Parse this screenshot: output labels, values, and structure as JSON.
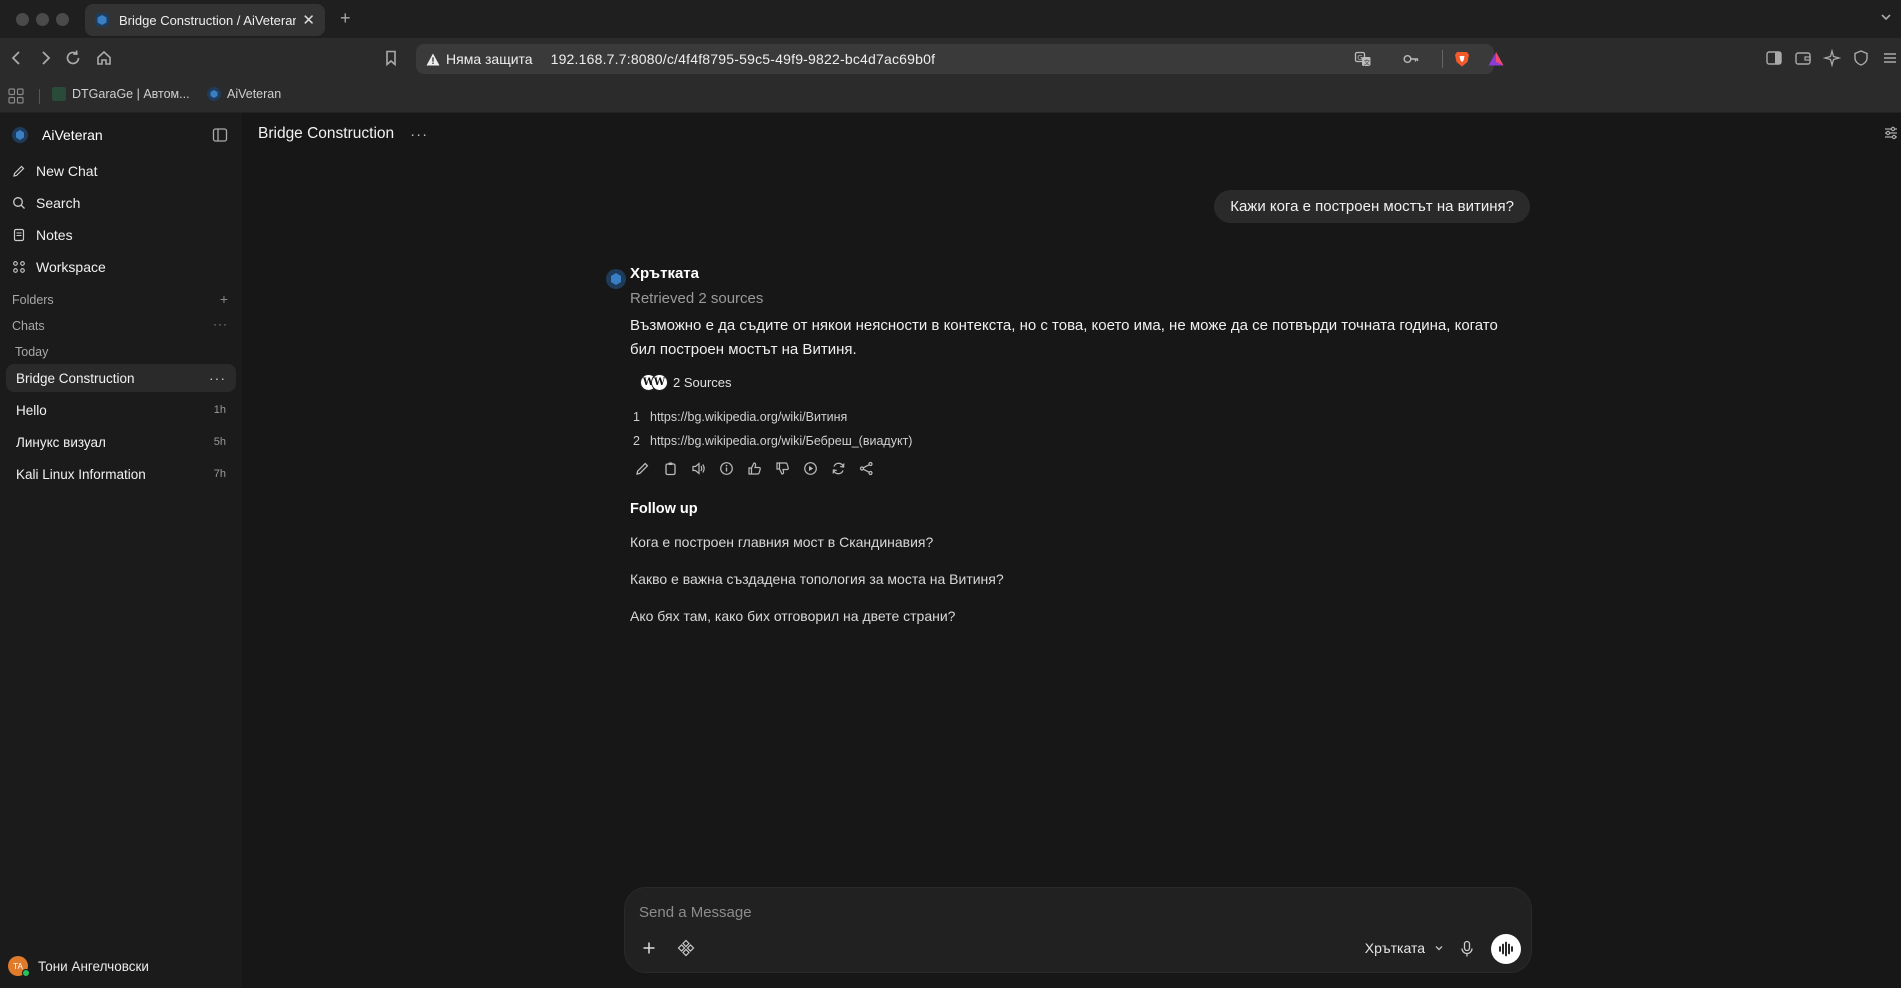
{
  "browser": {
    "tab_title": "Bridge Construction / AiVeteran",
    "security_label": "Няма защита",
    "url": "192.168.7.7:8080/c/4f4f8795-59c5-49f9-9822-bc4d7ac69b0f",
    "bookmarks": [
      "DTGaraGe | Автом...",
      "AiVeteran"
    ]
  },
  "sidebar": {
    "app_name": "AiVeteran",
    "nav": [
      "New Chat",
      "Search",
      "Notes",
      "Workspace"
    ],
    "folders_label": "Folders",
    "chats_label": "Chats",
    "today_label": "Today",
    "chats": [
      {
        "title": "Bridge Construction",
        "time": ""
      },
      {
        "title": "Hello",
        "time": "1h"
      },
      {
        "title": "Линукс визуал",
        "time": "5h"
      },
      {
        "title": "Kali Linux Information",
        "time": "7h"
      }
    ],
    "user_initials": "TA",
    "user_name": "Тони Ангелчовски"
  },
  "chat": {
    "title": "Bridge Construction",
    "user_message": "Кажи кога е построен мостът на витиня?",
    "assistant": {
      "name": "Хрътката",
      "retrieved": "Retrieved 2 sources",
      "text": "Възможно е да съдите от някои неясности в контекста, но с това, което има, не може да се потвърди точната година, когато бил построен мостът на Витиня.",
      "sources_label": "2 Sources",
      "sources": [
        {
          "n": "1",
          "url": "https://bg.wikipedia.org/wiki/Витиня"
        },
        {
          "n": "2",
          "url": "https://bg.wikipedia.org/wiki/Бебреш_(виадукт)"
        }
      ],
      "actions": [
        "edit-icon",
        "copy-icon",
        "speaker-icon",
        "info-icon",
        "thumbs-up-icon",
        "thumbs-down-icon",
        "play-icon",
        "regenerate-icon",
        "share-icon"
      ]
    },
    "followup_title": "Follow up",
    "followups": [
      "Кога е построен главния мост в Скандинавия?",
      "Какво е важна създадена топология за моста на Витиня?",
      "Ако бях там, како бих отговорил на двете страни?"
    ]
  },
  "composer": {
    "placeholder": "Send a Message",
    "model": "Хрътката"
  },
  "colors": {
    "background": "#171717",
    "sidebar": "#1b1b1b",
    "bubble": "#2a2a2a",
    "avatar": "#e07b2c",
    "online": "#22c55e"
  }
}
